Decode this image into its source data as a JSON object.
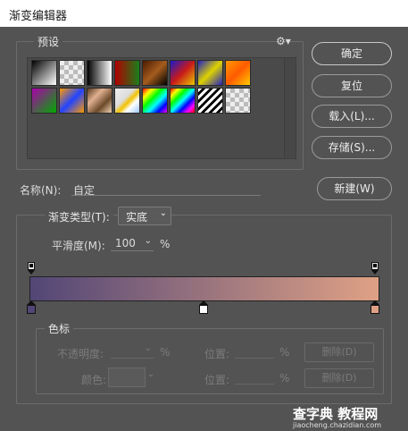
{
  "window": {
    "title": "渐变编辑器"
  },
  "presets": {
    "legend": "预设",
    "gear_icon": "gear-icon",
    "swatches": [
      "linear-gradient(135deg,#000 0%,#fff 100%)",
      "conic-gradient(#bbb 25%,#eee 0 50%,#bbb 0 75%,#eee 0) 0 0/10px 10px",
      "linear-gradient(90deg,#000,#fff)",
      "linear-gradient(90deg,#b10000,#1a7f1a)",
      "linear-gradient(135deg,#4a1a00,#a45c1e,#000)",
      "linear-gradient(135deg,#1a1ac8,#c81a1a,#e8c800)",
      "linear-gradient(135deg,#2222c0,#ddd200,#2222c0)",
      "linear-gradient(135deg,#ff9900,#ff5a00,#ffcc00)",
      "linear-gradient(135deg,#aa00aa,#00aa00)",
      "linear-gradient(135deg,#ff9900,#2244ff,#ff9900)",
      "linear-gradient(135deg,#5a3a20,#e0b090,#6b4a2a,#f2d4b4)",
      "linear-gradient(135deg,#eee,#ddd 40%,#f2c200 55%,#fff 70%,#9ec8ff)",
      "linear-gradient(135deg,#f00,#ff0,#0f0,#0ff,#00f,#f0f)",
      "linear-gradient(135deg,#f00,#ff0,#0f0,#0ff,#00f,#f0f,#f00)",
      "repeating-linear-gradient(135deg,#fff 0 3px,#000 3px 6px)",
      "conic-gradient(#bbb 25%,#eee 0 50%,#bbb 0 75%,#eee 0) 0 0/10px 10px"
    ]
  },
  "buttons": {
    "ok": "确定",
    "reset": "复位",
    "load": "载入(L)...",
    "save": "存储(S)...",
    "new": "新建(W)"
  },
  "name_row": {
    "label": "名称(N):",
    "value": "自定"
  },
  "gradient": {
    "type_label": "渐变类型(T):",
    "type_value": "实底",
    "smoothness_label": "平滑度(M):",
    "smoothness_value": "100",
    "smoothness_unit": "%",
    "colors": {
      "start": "#524676",
      "end": "#dfa185"
    },
    "opacity_stops": [
      0,
      100
    ],
    "color_stops": [
      {
        "position": 0,
        "color": "#524676"
      },
      {
        "position": 50,
        "color": "#ffffff"
      },
      {
        "position": 100,
        "color": "#dfa185"
      }
    ]
  },
  "stops_panel": {
    "legend": "色标",
    "opacity_label": "不透明度:",
    "opacity_unit": "%",
    "location_label": "位置:",
    "location_unit": "%",
    "delete_label": "删除(D)",
    "color_label": "颜色:",
    "location2_label": "位置:",
    "location2_unit": "%",
    "delete2_label": "删除(D)"
  },
  "watermark": {
    "main": "查字典 教程网",
    "sub": "jiaocheng.chazidian.com"
  }
}
